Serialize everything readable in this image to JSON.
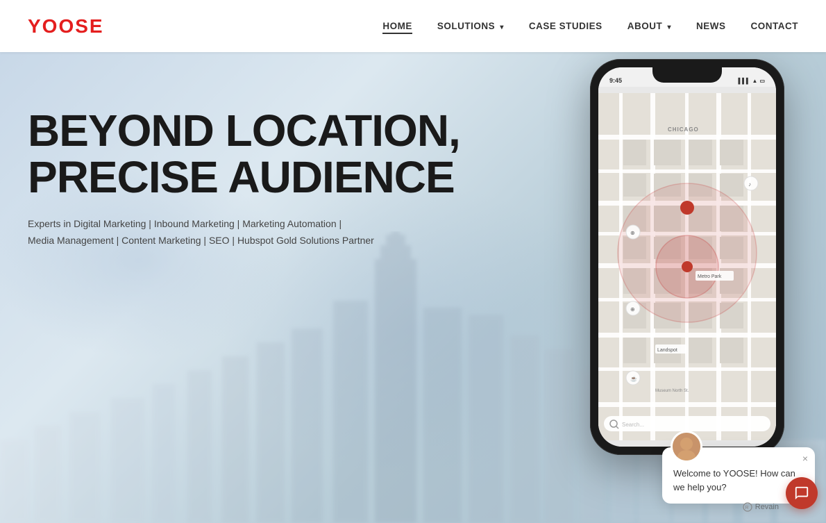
{
  "brand": {
    "name": "YOOSE"
  },
  "nav": {
    "links": [
      {
        "id": "home",
        "label": "HOME",
        "active": true,
        "hasDropdown": false
      },
      {
        "id": "solutions",
        "label": "SOLUTIONS",
        "active": false,
        "hasDropdown": true
      },
      {
        "id": "case-studies",
        "label": "CASE STUDIES",
        "active": false,
        "hasDropdown": false
      },
      {
        "id": "about",
        "label": "ABOUT",
        "active": false,
        "hasDropdown": true
      },
      {
        "id": "news",
        "label": "NEWS",
        "active": false,
        "hasDropdown": false
      },
      {
        "id": "contact",
        "label": "CONTACT",
        "active": false,
        "hasDropdown": false
      }
    ]
  },
  "hero": {
    "title_line1": "BEYOND LOCATION,",
    "title_line2": "PRECISE AUDIENCE",
    "subtitle_line1": "Experts in Digital Marketing | Inbound Marketing | Marketing Automation |",
    "subtitle_line2": "Media Management | Content Marketing | SEO | Hubspot Gold Solutions Partner"
  },
  "phone": {
    "time": "9:45",
    "city_label": "CHICAGO",
    "location_label": "Metro Park",
    "location_label2": "Landspot",
    "search_placeholder": "Searc..."
  },
  "chat": {
    "greeting": "Welcome to YOOSE! How can we help you?",
    "close_icon": "×"
  },
  "revain": {
    "label": "Revain"
  }
}
